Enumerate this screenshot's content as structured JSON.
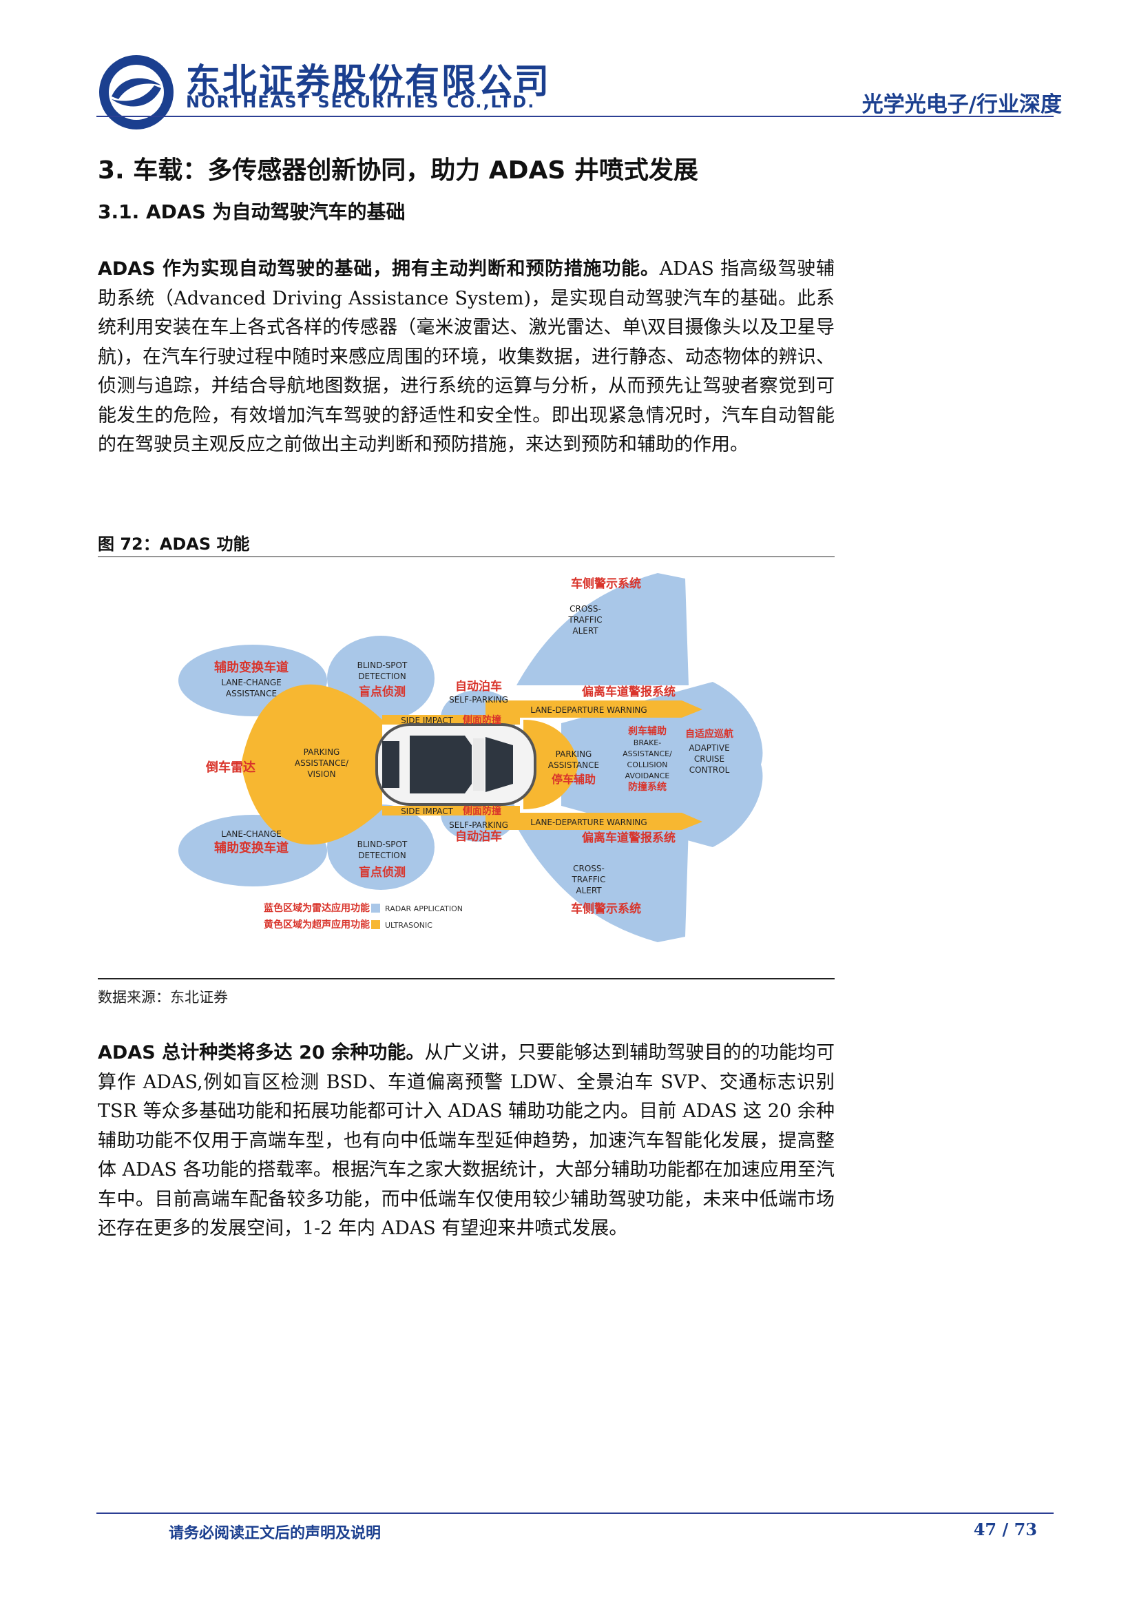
{
  "header": {
    "company_cn": "东北证券股份有限公司",
    "company_en": "NORTHEAST SECURITIES CO.,LTD.",
    "category": "光学光电子/行业深度",
    "brand_color": "#1b3f8f"
  },
  "section": {
    "h1": "3. 车载：多传感器创新协同，助力 ADAS 井喷式发展",
    "h2": "3.1. ADAS 为自动驾驶汽车的基础"
  },
  "para1": {
    "lead": "ADAS 作为实现自动驾驶的基础，拥有主动判断和预防措施功能。",
    "body": "ADAS 指高级驾驶辅助系统（Advanced Driving Assistance System)，是实现自动驾驶汽车的基础。此系统利用安装在车上各式各样的传感器（毫米波雷达、激光雷达、单\\双目摄像头以及卫星导航)，在汽车行驶过程中随时来感应周围的环境，收集数据，进行静态、动态物体的辨识、侦测与追踪，并结合导航地图数据，进行系统的运算与分析，从而预先让驾驶者察觉到可能发生的危险，有效增加汽车驾驶的舒适性和安全性。即出现紧急情况时，汽车自动智能的在驾驶员主观反应之前做出主动判断和预防措施，来达到预防和辅助的作用。"
  },
  "figure": {
    "title": "图 72：ADAS 功能",
    "source": "数据来源：东北证券",
    "labels": {
      "cta_top_cn": "车侧警示系统",
      "cta_top_en1": "CROSS-",
      "cta_top_en2": "TRAFFIC",
      "cta_top_en3": "ALERT",
      "lca_top_cn": "辅助变换车道",
      "lca_top_en1": "LANE-CHANGE",
      "lca_top_en2": "ASSISTANCE",
      "bsd_top_en1": "BLIND-SPOT",
      "bsd_top_en2": "DETECTION",
      "bsd_top_cn": "盲点侦测",
      "sp_top_cn": "自动泊车",
      "sp_top_en": "SELF-PARKING",
      "ldw_top_cn": "偏离车道警报系统",
      "ldw_top_en": "LANE-DEPARTURE WARNING",
      "si_top_en": "SIDE IMPACT",
      "si_top_cn": "侧面防撞",
      "rear_cn": "倒车雷达",
      "rear_en1": "PARKING",
      "rear_en2": "ASSISTANCE/",
      "rear_en3": "VISION",
      "front_en1": "PARKING",
      "front_en2": "ASSISTANCE",
      "front_cn": "停车辅助",
      "brake_cn": "刹车辅助",
      "brake_en1": "BRAKE-",
      "brake_en2": "ASSISTANCE/",
      "brake_en3": "COLLISION",
      "brake_en4": "AVOIDANCE",
      "brake_cn2": "防撞系统",
      "acc_cn": "自适应巡航",
      "acc_en1": "ADAPTIVE",
      "acc_en2": "CRUISE",
      "acc_en3": "CONTROL",
      "si_bot_en": "SIDE IMPACT",
      "si_bot_cn": "侧面防撞",
      "sp_bot_en": "SELF-PARKING",
      "sp_bot_cn": "自动泊车",
      "ldw_bot_en": "LANE-DEPARTURE WARNING",
      "ldw_bot_cn": "偏离车道警报系统",
      "lca_bot_en": "LANE-CHANGE",
      "lca_bot_cn": "辅助变换车道",
      "bsd_bot_en1": "BLIND-SPOT",
      "bsd_bot_en2": "DETECTION",
      "bsd_bot_cn": "盲点侦测",
      "cta_bot_en1": "CROSS-",
      "cta_bot_en2": "TRAFFIC",
      "cta_bot_en3": "ALERT",
      "cta_bot_cn": "车侧警示系统",
      "legend_blue_cn": "蓝色区域为雷达应用功能",
      "legend_blue_en": "RADAR APPLICATION",
      "legend_yellow_cn": "黄色区域为超声应用功能",
      "legend_yellow_en": "ULTRASONIC"
    },
    "colors": {
      "radar": "#a9c7e8",
      "ultrasonic": "#f7b731",
      "red_label": "#d9342b"
    }
  },
  "para2": {
    "lead": "ADAS 总计种类将多达 20 余种功能。",
    "body": "从广义讲，只要能够达到辅助驾驶目的的功能均可算作 ADAS,例如盲区检测 BSD、车道偏离预警 LDW、全景泊车 SVP、交通标志识别 TSR 等众多基础功能和拓展功能都可计入 ADAS 辅助功能之内。目前 ADAS 这 20 余种辅助功能不仅用于高端车型，也有向中低端车型延伸趋势，加速汽车智能化发展，提高整体 ADAS 各功能的搭载率。根据汽车之家大数据统计，大部分辅助功能都在加速应用至汽车中。目前高端车配备较多功能，而中低端车仅使用较少辅助驾驶功能，未来中低端市场还存在更多的发展空间，1-2 年内 ADAS 有望迎来井喷式发展。"
  },
  "footer": {
    "disclaimer": "请务必阅读正文后的声明及说明",
    "page": "47 / 73"
  }
}
